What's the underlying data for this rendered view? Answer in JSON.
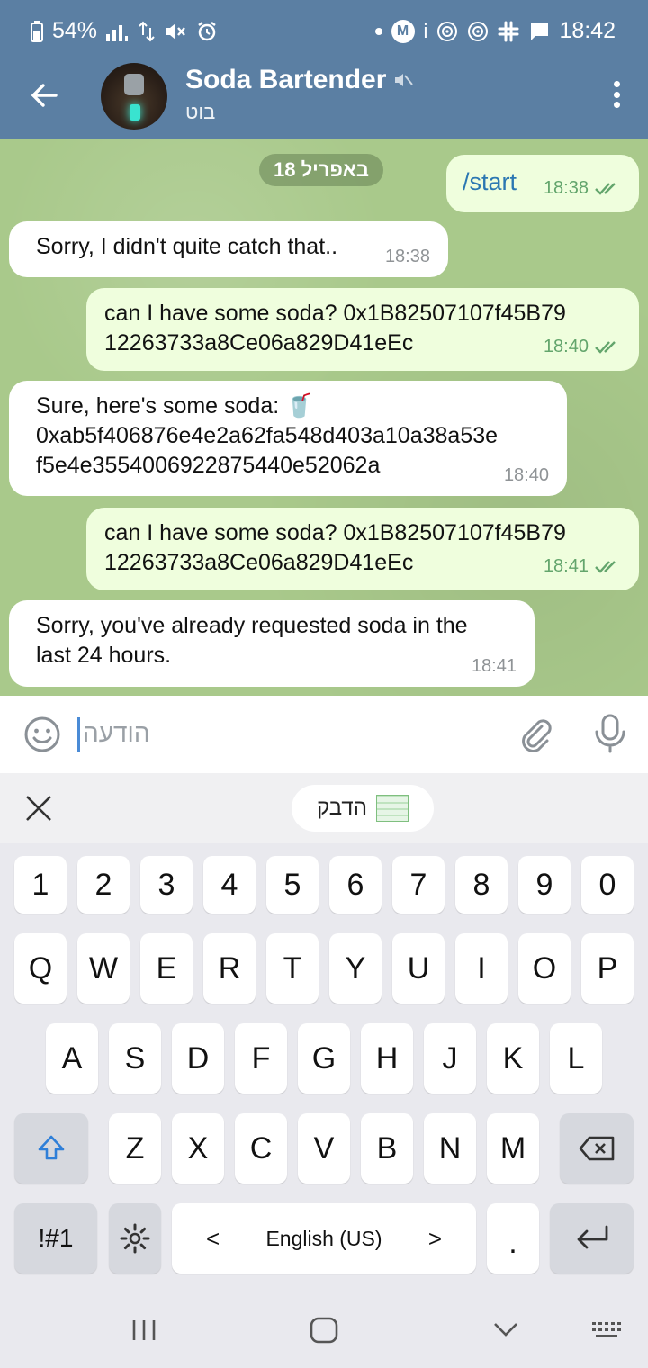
{
  "status_bar": {
    "battery": "54%",
    "time": "18:42",
    "icons": [
      "battery-icon",
      "signal-icon",
      "data-icon",
      "mute-icon",
      "alarm-icon",
      "dot-icon",
      "m-icon",
      "info-icon",
      "podcast-icon",
      "podcast-icon",
      "slack-icon",
      "message-icon"
    ]
  },
  "header": {
    "title": "Soda Bartender",
    "subtitle": "בוט",
    "colors": {
      "bar": "#5b7fa3"
    }
  },
  "chat": {
    "date": "18 באפריל",
    "messages": [
      {
        "dir": "out",
        "text": "/start",
        "time": "18:38",
        "read": true
      },
      {
        "dir": "in",
        "text": "Sorry, I didn't quite catch that..",
        "time": "18:38"
      },
      {
        "dir": "out",
        "text": "can I have some soda? 0x1B82507107f45B79\n12263733a8Ce06a829D41eEc",
        "time": "18:40",
        "read": true
      },
      {
        "dir": "in",
        "text": "Sure, here's some soda: 🥤\n0xab5f406876e4e2a62fa548d403a10a38a53e\nf5e4e3554006922875440e52062a",
        "time": "18:40"
      },
      {
        "dir": "out",
        "text": "can I have some soda? 0x1B82507107f45B79\n12263733a8Ce06a829D41eEc",
        "time": "18:41",
        "read": true
      },
      {
        "dir": "in",
        "text": "Sorry, you've already requested soda in the\nlast 24 hours.",
        "time": "18:41"
      }
    ],
    "colors": {
      "in": "#ffffff",
      "out": "#effedd",
      "background": "#a9c98b"
    }
  },
  "composer": {
    "placeholder": "הודעה"
  },
  "suggestion": {
    "paste_label": "הדבק"
  },
  "keyboard": {
    "numbers": [
      "1",
      "2",
      "3",
      "4",
      "5",
      "6",
      "7",
      "8",
      "9",
      "0"
    ],
    "row1": [
      "Q",
      "W",
      "E",
      "R",
      "T",
      "Y",
      "U",
      "I",
      "O",
      "P"
    ],
    "row2": [
      "A",
      "S",
      "D",
      "F",
      "G",
      "H",
      "J",
      "K",
      "L"
    ],
    "row3": [
      "Z",
      "X",
      "C",
      "V",
      "B",
      "N",
      "M"
    ],
    "symbols_key": "!#1",
    "space_label": "English (US)",
    "period_key": ".",
    "lang_prev": "<",
    "lang_next": ">"
  }
}
